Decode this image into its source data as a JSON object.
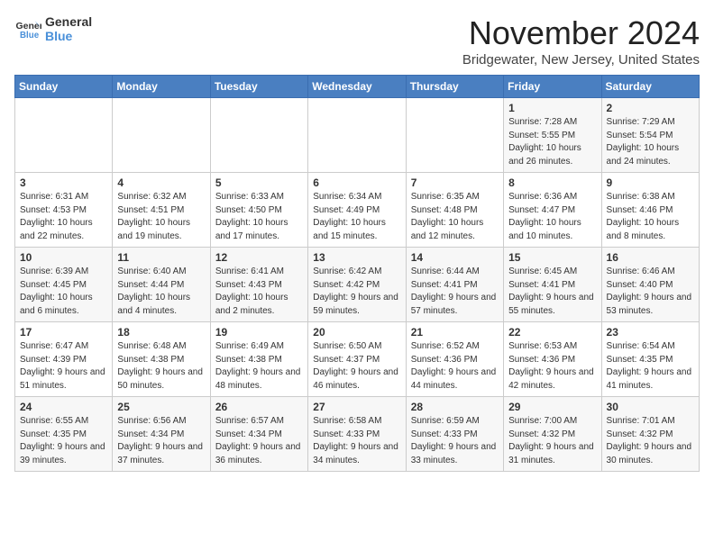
{
  "header": {
    "logo_line1": "General",
    "logo_line2": "Blue",
    "month": "November 2024",
    "location": "Bridgewater, New Jersey, United States"
  },
  "weekdays": [
    "Sunday",
    "Monday",
    "Tuesday",
    "Wednesday",
    "Thursday",
    "Friday",
    "Saturday"
  ],
  "weeks": [
    [
      {
        "day": "",
        "info": ""
      },
      {
        "day": "",
        "info": ""
      },
      {
        "day": "",
        "info": ""
      },
      {
        "day": "",
        "info": ""
      },
      {
        "day": "",
        "info": ""
      },
      {
        "day": "1",
        "info": "Sunrise: 7:28 AM\nSunset: 5:55 PM\nDaylight: 10 hours and 26 minutes."
      },
      {
        "day": "2",
        "info": "Sunrise: 7:29 AM\nSunset: 5:54 PM\nDaylight: 10 hours and 24 minutes."
      }
    ],
    [
      {
        "day": "3",
        "info": "Sunrise: 6:31 AM\nSunset: 4:53 PM\nDaylight: 10 hours and 22 minutes."
      },
      {
        "day": "4",
        "info": "Sunrise: 6:32 AM\nSunset: 4:51 PM\nDaylight: 10 hours and 19 minutes."
      },
      {
        "day": "5",
        "info": "Sunrise: 6:33 AM\nSunset: 4:50 PM\nDaylight: 10 hours and 17 minutes."
      },
      {
        "day": "6",
        "info": "Sunrise: 6:34 AM\nSunset: 4:49 PM\nDaylight: 10 hours and 15 minutes."
      },
      {
        "day": "7",
        "info": "Sunrise: 6:35 AM\nSunset: 4:48 PM\nDaylight: 10 hours and 12 minutes."
      },
      {
        "day": "8",
        "info": "Sunrise: 6:36 AM\nSunset: 4:47 PM\nDaylight: 10 hours and 10 minutes."
      },
      {
        "day": "9",
        "info": "Sunrise: 6:38 AM\nSunset: 4:46 PM\nDaylight: 10 hours and 8 minutes."
      }
    ],
    [
      {
        "day": "10",
        "info": "Sunrise: 6:39 AM\nSunset: 4:45 PM\nDaylight: 10 hours and 6 minutes."
      },
      {
        "day": "11",
        "info": "Sunrise: 6:40 AM\nSunset: 4:44 PM\nDaylight: 10 hours and 4 minutes."
      },
      {
        "day": "12",
        "info": "Sunrise: 6:41 AM\nSunset: 4:43 PM\nDaylight: 10 hours and 2 minutes."
      },
      {
        "day": "13",
        "info": "Sunrise: 6:42 AM\nSunset: 4:42 PM\nDaylight: 9 hours and 59 minutes."
      },
      {
        "day": "14",
        "info": "Sunrise: 6:44 AM\nSunset: 4:41 PM\nDaylight: 9 hours and 57 minutes."
      },
      {
        "day": "15",
        "info": "Sunrise: 6:45 AM\nSunset: 4:41 PM\nDaylight: 9 hours and 55 minutes."
      },
      {
        "day": "16",
        "info": "Sunrise: 6:46 AM\nSunset: 4:40 PM\nDaylight: 9 hours and 53 minutes."
      }
    ],
    [
      {
        "day": "17",
        "info": "Sunrise: 6:47 AM\nSunset: 4:39 PM\nDaylight: 9 hours and 51 minutes."
      },
      {
        "day": "18",
        "info": "Sunrise: 6:48 AM\nSunset: 4:38 PM\nDaylight: 9 hours and 50 minutes."
      },
      {
        "day": "19",
        "info": "Sunrise: 6:49 AM\nSunset: 4:38 PM\nDaylight: 9 hours and 48 minutes."
      },
      {
        "day": "20",
        "info": "Sunrise: 6:50 AM\nSunset: 4:37 PM\nDaylight: 9 hours and 46 minutes."
      },
      {
        "day": "21",
        "info": "Sunrise: 6:52 AM\nSunset: 4:36 PM\nDaylight: 9 hours and 44 minutes."
      },
      {
        "day": "22",
        "info": "Sunrise: 6:53 AM\nSunset: 4:36 PM\nDaylight: 9 hours and 42 minutes."
      },
      {
        "day": "23",
        "info": "Sunrise: 6:54 AM\nSunset: 4:35 PM\nDaylight: 9 hours and 41 minutes."
      }
    ],
    [
      {
        "day": "24",
        "info": "Sunrise: 6:55 AM\nSunset: 4:35 PM\nDaylight: 9 hours and 39 minutes."
      },
      {
        "day": "25",
        "info": "Sunrise: 6:56 AM\nSunset: 4:34 PM\nDaylight: 9 hours and 37 minutes."
      },
      {
        "day": "26",
        "info": "Sunrise: 6:57 AM\nSunset: 4:34 PM\nDaylight: 9 hours and 36 minutes."
      },
      {
        "day": "27",
        "info": "Sunrise: 6:58 AM\nSunset: 4:33 PM\nDaylight: 9 hours and 34 minutes."
      },
      {
        "day": "28",
        "info": "Sunrise: 6:59 AM\nSunset: 4:33 PM\nDaylight: 9 hours and 33 minutes."
      },
      {
        "day": "29",
        "info": "Sunrise: 7:00 AM\nSunset: 4:32 PM\nDaylight: 9 hours and 31 minutes."
      },
      {
        "day": "30",
        "info": "Sunrise: 7:01 AM\nSunset: 4:32 PM\nDaylight: 9 hours and 30 minutes."
      }
    ]
  ]
}
